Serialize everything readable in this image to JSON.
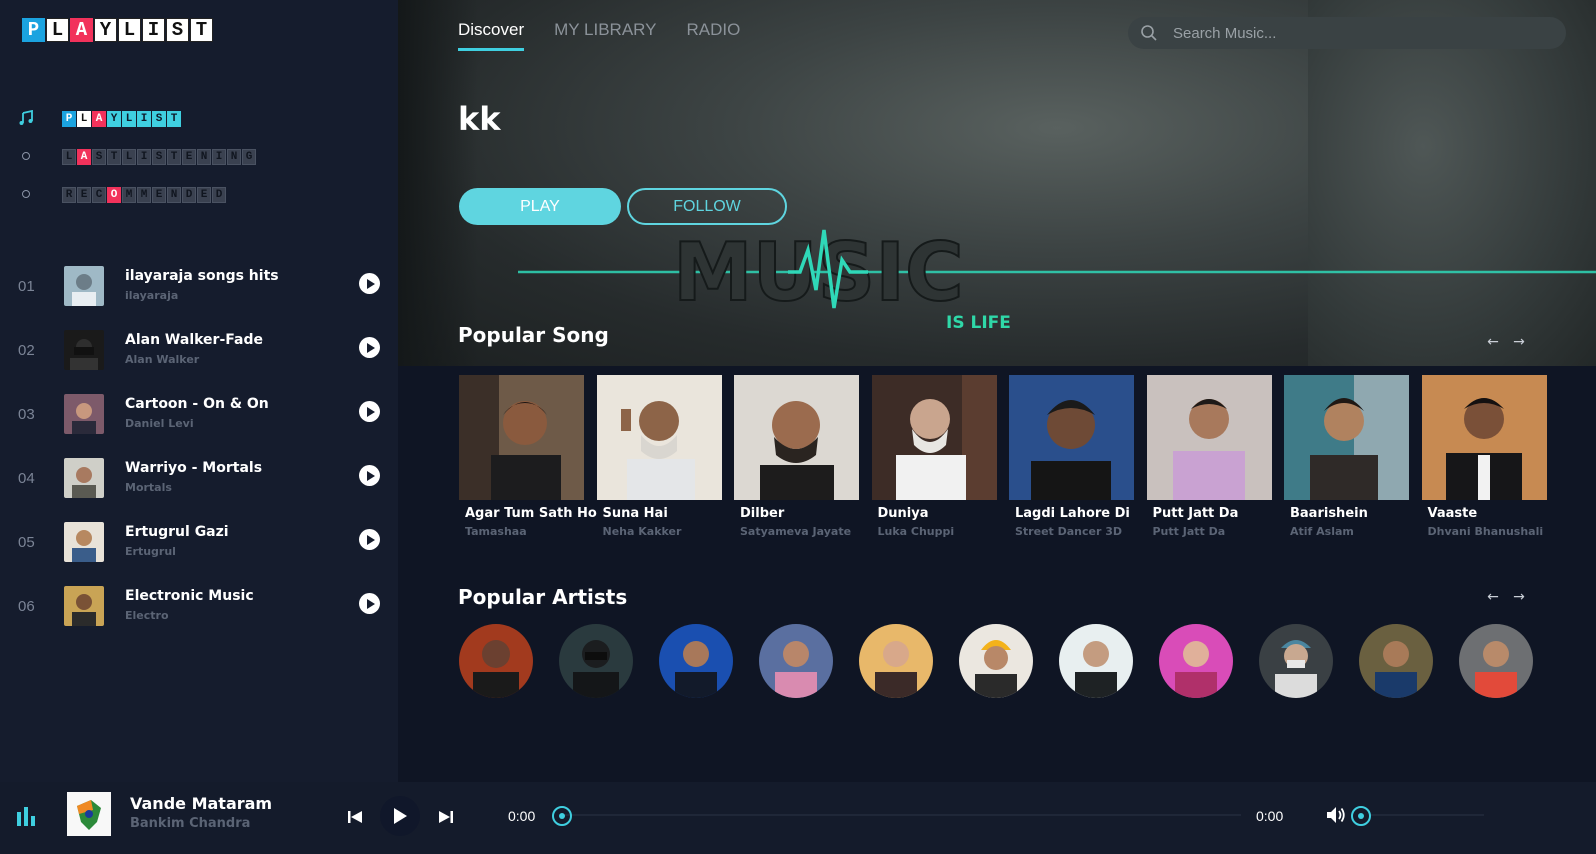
{
  "logo": {
    "letters": [
      "P",
      "L",
      "A",
      "Y",
      "L",
      "I",
      "S",
      "T"
    ]
  },
  "menu": [
    {
      "key": "playlist",
      "letters": [
        "P",
        "L",
        "A",
        "Y",
        "L",
        "I",
        "S",
        "T"
      ]
    },
    {
      "key": "last-listening",
      "letters": [
        "L",
        "A",
        "S",
        "T",
        "L",
        "I",
        "S",
        "T",
        "E",
        "N",
        "I",
        "N",
        "G"
      ]
    },
    {
      "key": "recommended",
      "letters": [
        "R",
        "E",
        "C",
        "O",
        "M",
        "M",
        "E",
        "N",
        "D",
        "E",
        "D"
      ]
    }
  ],
  "tracks": [
    {
      "num": "01",
      "title": "ilayaraja songs hits",
      "artist": "ilayaraja"
    },
    {
      "num": "02",
      "title": "Alan Walker-Fade",
      "artist": "Alan Walker"
    },
    {
      "num": "03",
      "title": "Cartoon - On & On",
      "artist": "Daniel Levi"
    },
    {
      "num": "04",
      "title": "Warriyo - Mortals",
      "artist": "Mortals"
    },
    {
      "num": "05",
      "title": "Ertugrul Gazi",
      "artist": "Ertugrul"
    },
    {
      "num": "06",
      "title": "Electronic Music",
      "artist": "Electro"
    }
  ],
  "nav": {
    "tabs": [
      "Discover",
      "MY LIBRARY",
      "RADIO"
    ]
  },
  "search": {
    "placeholder": "Search Music..."
  },
  "hero": {
    "title": "kk",
    "play_label": "PLAY",
    "follow_label": "FOLLOW",
    "art_word": "MUSIC",
    "art_tagline": "IS LIFE"
  },
  "popular_songs": {
    "title": "Popular Song",
    "items": [
      {
        "title": "Agar Tum Sath Ho",
        "artist": "Tamashaa"
      },
      {
        "title": "Suna Hai",
        "artist": "Neha Kakker"
      },
      {
        "title": "Dilber",
        "artist": "Satyameva Jayate"
      },
      {
        "title": "Duniya",
        "artist": "Luka Chuppi"
      },
      {
        "title": "Lagdi Lahore Di",
        "artist": "Street Dancer 3D"
      },
      {
        "title": "Putt Jatt Da",
        "artist": "Putt Jatt Da"
      },
      {
        "title": "Baarishein",
        "artist": "Atif Aslam"
      },
      {
        "title": "Vaaste",
        "artist": "Dhvani Bhanushali"
      }
    ]
  },
  "popular_artists": {
    "title": "Popular Artists",
    "count": 11
  },
  "player": {
    "title": "Vande Mataram",
    "artist": "Bankim Chandra",
    "current_time": "0:00",
    "duration": "0:00"
  },
  "colors": {
    "accent": "#3fcfe0",
    "brand_red": "#f2325b",
    "brand_blue": "#1ba3e0",
    "bg": "#0f1524",
    "sidebar": "#151c2d"
  }
}
